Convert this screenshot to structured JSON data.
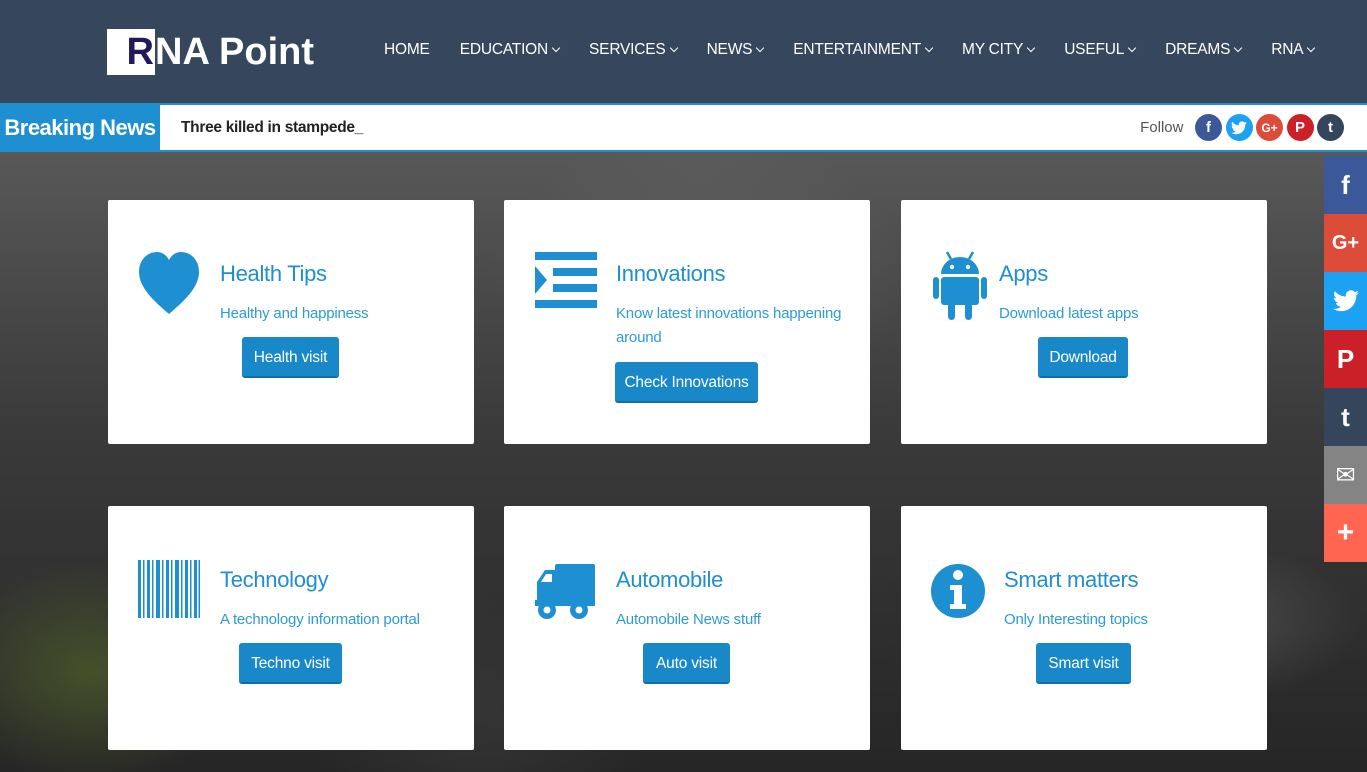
{
  "header": {
    "logo": {
      "initial": "R",
      "rest": "NA Point"
    },
    "nav": [
      {
        "label": "HOME",
        "dropdown": false
      },
      {
        "label": "EDUCATION",
        "dropdown": true
      },
      {
        "label": "SERVICES",
        "dropdown": true
      },
      {
        "label": "NEWS",
        "dropdown": true
      },
      {
        "label": "ENTERTAINMENT",
        "dropdown": true
      },
      {
        "label": "MY CITY",
        "dropdown": true
      },
      {
        "label": "USEFUL",
        "dropdown": true
      },
      {
        "label": "DREAMS",
        "dropdown": true
      },
      {
        "label": "RNA",
        "dropdown": true
      }
    ]
  },
  "breaking": {
    "label": "Breaking News",
    "headline": "Three killed in stampede_",
    "follow_label": "Follow",
    "follow_icons": [
      {
        "name": "facebook-icon",
        "glyph": "f",
        "color": "#3b5998"
      },
      {
        "name": "twitter-icon",
        "glyph": "t",
        "color": "#1da1f2"
      },
      {
        "name": "google-plus-icon",
        "glyph": "G+",
        "color": "#dd4b39"
      },
      {
        "name": "pinterest-icon",
        "glyph": "P",
        "color": "#cb2027"
      },
      {
        "name": "tumblr-icon",
        "glyph": "t",
        "color": "#35465c"
      }
    ]
  },
  "share_sidebar": [
    {
      "name": "share-facebook-icon",
      "glyph": "f",
      "color": "#3b5998"
    },
    {
      "name": "share-google-plus-icon",
      "glyph": "G+",
      "color": "#dd4b39"
    },
    {
      "name": "share-twitter-icon",
      "glyph": "t",
      "color": "#1da1f2"
    },
    {
      "name": "share-pinterest-icon",
      "glyph": "P",
      "color": "#cb2027"
    },
    {
      "name": "share-tumblr-icon",
      "glyph": "t",
      "color": "#35465c"
    },
    {
      "name": "share-email-icon",
      "glyph": "✉",
      "color": "#848484"
    },
    {
      "name": "share-more-icon",
      "glyph": "+",
      "color": "#ff6550"
    }
  ],
  "cards": [
    {
      "icon": "heart-icon",
      "title": "Health Tips",
      "desc": "Healthy and happiness",
      "button": "Health visit"
    },
    {
      "icon": "indent-list-icon",
      "title": "Innovations",
      "desc": "Know latest innovations happening around",
      "button": "Check Innovations"
    },
    {
      "icon": "android-icon",
      "title": "Apps",
      "desc": "Download latest apps",
      "button": "Download"
    },
    {
      "icon": "barcode-icon",
      "title": "Technology",
      "desc": "A technology information portal",
      "button": "Techno visit"
    },
    {
      "icon": "truck-icon",
      "title": "Automobile",
      "desc": "Automobile News stuff",
      "button": "Auto visit"
    },
    {
      "icon": "info-icon",
      "title": "Smart matters",
      "desc": "Only Interesting topics",
      "button": "Smart visit"
    }
  ],
  "colors": {
    "header_bg": "#36465c",
    "accent": "#1e8fd0",
    "button": "#1888c8"
  }
}
